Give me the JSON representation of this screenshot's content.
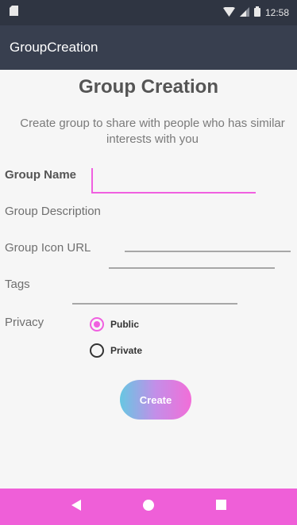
{
  "status_bar": {
    "time": "12:58"
  },
  "app_bar": {
    "title": "GroupCreation"
  },
  "form": {
    "heading": "Group Creation",
    "subtitle": "Create group to share with people who has similar interests with you",
    "group_name_label": "Group Name",
    "group_name_value": "",
    "group_description_label": "Group Description",
    "group_description_value": "",
    "group_icon_url_label": "Group Icon URL",
    "group_icon_url_value": "",
    "tags_label": "Tags",
    "tags_value": "",
    "privacy_label": "Privacy",
    "privacy_options": [
      {
        "label": "Public",
        "selected": true
      },
      {
        "label": "Private",
        "selected": false
      }
    ],
    "create_label": "Create"
  },
  "colors": {
    "accent": "#f060e0",
    "status_bar": "#2f3542",
    "app_bar": "#383f4f",
    "nav_bar": "#ef5fd8",
    "button_gradient_start": "#66c7e2",
    "button_gradient_end": "#f26ed8"
  },
  "icons": {
    "status": [
      "sim-card-icon",
      "wifi-icon",
      "signal-icon",
      "battery-icon"
    ],
    "nav": [
      "back-icon",
      "home-icon",
      "recents-icon"
    ]
  }
}
